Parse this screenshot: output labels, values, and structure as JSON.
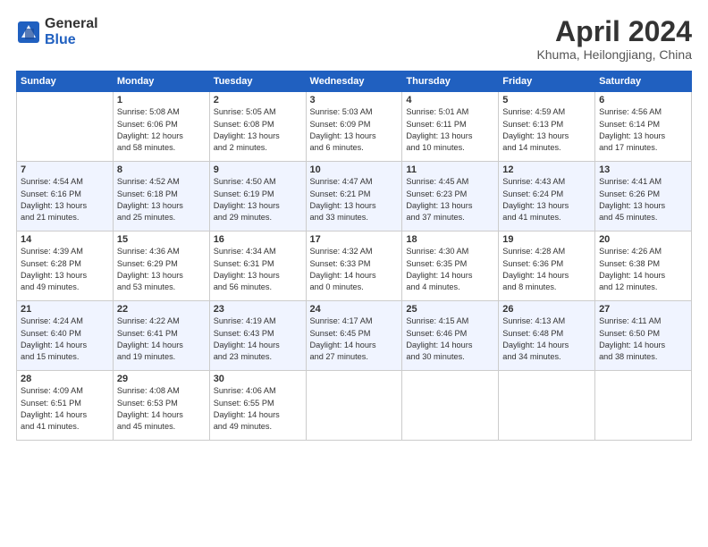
{
  "header": {
    "logo_general": "General",
    "logo_blue": "Blue",
    "title": "April 2024",
    "location": "Khuma, Heilongjiang, China"
  },
  "days_header": [
    "Sunday",
    "Monday",
    "Tuesday",
    "Wednesday",
    "Thursday",
    "Friday",
    "Saturday"
  ],
  "weeks": [
    [
      {
        "num": "",
        "info": ""
      },
      {
        "num": "1",
        "info": "Sunrise: 5:08 AM\nSunset: 6:06 PM\nDaylight: 12 hours\nand 58 minutes."
      },
      {
        "num": "2",
        "info": "Sunrise: 5:05 AM\nSunset: 6:08 PM\nDaylight: 13 hours\nand 2 minutes."
      },
      {
        "num": "3",
        "info": "Sunrise: 5:03 AM\nSunset: 6:09 PM\nDaylight: 13 hours\nand 6 minutes."
      },
      {
        "num": "4",
        "info": "Sunrise: 5:01 AM\nSunset: 6:11 PM\nDaylight: 13 hours\nand 10 minutes."
      },
      {
        "num": "5",
        "info": "Sunrise: 4:59 AM\nSunset: 6:13 PM\nDaylight: 13 hours\nand 14 minutes."
      },
      {
        "num": "6",
        "info": "Sunrise: 4:56 AM\nSunset: 6:14 PM\nDaylight: 13 hours\nand 17 minutes."
      }
    ],
    [
      {
        "num": "7",
        "info": "Sunrise: 4:54 AM\nSunset: 6:16 PM\nDaylight: 13 hours\nand 21 minutes."
      },
      {
        "num": "8",
        "info": "Sunrise: 4:52 AM\nSunset: 6:18 PM\nDaylight: 13 hours\nand 25 minutes."
      },
      {
        "num": "9",
        "info": "Sunrise: 4:50 AM\nSunset: 6:19 PM\nDaylight: 13 hours\nand 29 minutes."
      },
      {
        "num": "10",
        "info": "Sunrise: 4:47 AM\nSunset: 6:21 PM\nDaylight: 13 hours\nand 33 minutes."
      },
      {
        "num": "11",
        "info": "Sunrise: 4:45 AM\nSunset: 6:23 PM\nDaylight: 13 hours\nand 37 minutes."
      },
      {
        "num": "12",
        "info": "Sunrise: 4:43 AM\nSunset: 6:24 PM\nDaylight: 13 hours\nand 41 minutes."
      },
      {
        "num": "13",
        "info": "Sunrise: 4:41 AM\nSunset: 6:26 PM\nDaylight: 13 hours\nand 45 minutes."
      }
    ],
    [
      {
        "num": "14",
        "info": "Sunrise: 4:39 AM\nSunset: 6:28 PM\nDaylight: 13 hours\nand 49 minutes."
      },
      {
        "num": "15",
        "info": "Sunrise: 4:36 AM\nSunset: 6:29 PM\nDaylight: 13 hours\nand 53 minutes."
      },
      {
        "num": "16",
        "info": "Sunrise: 4:34 AM\nSunset: 6:31 PM\nDaylight: 13 hours\nand 56 minutes."
      },
      {
        "num": "17",
        "info": "Sunrise: 4:32 AM\nSunset: 6:33 PM\nDaylight: 14 hours\nand 0 minutes."
      },
      {
        "num": "18",
        "info": "Sunrise: 4:30 AM\nSunset: 6:35 PM\nDaylight: 14 hours\nand 4 minutes."
      },
      {
        "num": "19",
        "info": "Sunrise: 4:28 AM\nSunset: 6:36 PM\nDaylight: 14 hours\nand 8 minutes."
      },
      {
        "num": "20",
        "info": "Sunrise: 4:26 AM\nSunset: 6:38 PM\nDaylight: 14 hours\nand 12 minutes."
      }
    ],
    [
      {
        "num": "21",
        "info": "Sunrise: 4:24 AM\nSunset: 6:40 PM\nDaylight: 14 hours\nand 15 minutes."
      },
      {
        "num": "22",
        "info": "Sunrise: 4:22 AM\nSunset: 6:41 PM\nDaylight: 14 hours\nand 19 minutes."
      },
      {
        "num": "23",
        "info": "Sunrise: 4:19 AM\nSunset: 6:43 PM\nDaylight: 14 hours\nand 23 minutes."
      },
      {
        "num": "24",
        "info": "Sunrise: 4:17 AM\nSunset: 6:45 PM\nDaylight: 14 hours\nand 27 minutes."
      },
      {
        "num": "25",
        "info": "Sunrise: 4:15 AM\nSunset: 6:46 PM\nDaylight: 14 hours\nand 30 minutes."
      },
      {
        "num": "26",
        "info": "Sunrise: 4:13 AM\nSunset: 6:48 PM\nDaylight: 14 hours\nand 34 minutes."
      },
      {
        "num": "27",
        "info": "Sunrise: 4:11 AM\nSunset: 6:50 PM\nDaylight: 14 hours\nand 38 minutes."
      }
    ],
    [
      {
        "num": "28",
        "info": "Sunrise: 4:09 AM\nSunset: 6:51 PM\nDaylight: 14 hours\nand 41 minutes."
      },
      {
        "num": "29",
        "info": "Sunrise: 4:08 AM\nSunset: 6:53 PM\nDaylight: 14 hours\nand 45 minutes."
      },
      {
        "num": "30",
        "info": "Sunrise: 4:06 AM\nSunset: 6:55 PM\nDaylight: 14 hours\nand 49 minutes."
      },
      {
        "num": "",
        "info": ""
      },
      {
        "num": "",
        "info": ""
      },
      {
        "num": "",
        "info": ""
      },
      {
        "num": "",
        "info": ""
      }
    ]
  ]
}
